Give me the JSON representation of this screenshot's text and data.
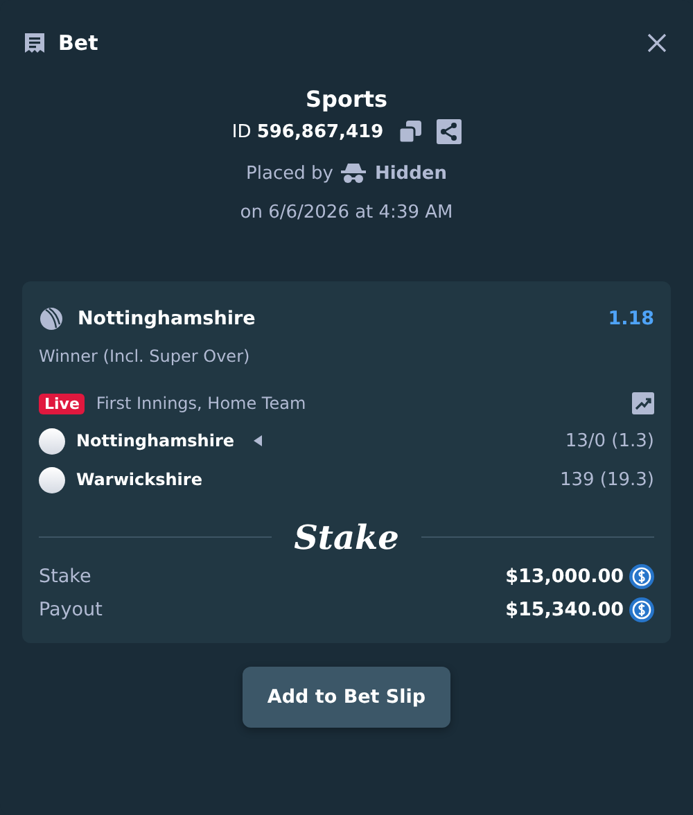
{
  "dialog": {
    "title": "Bet"
  },
  "header": {
    "category": "Sports",
    "id_label": "ID",
    "id_value": "596,867,419",
    "placed_by_label": "Placed by",
    "placed_by_user": "Hidden",
    "placed_on": "on 6/6/2026 at 4:39 AM"
  },
  "selection": {
    "team": "Nottinghamshire",
    "odds": "1.18",
    "market": "Winner (Incl. Super Over)"
  },
  "event": {
    "live_badge": "Live",
    "status": "First Innings, Home Team",
    "teams": [
      {
        "name": "Nottinghamshire",
        "batting": true,
        "score": "13/0 (1.3)"
      },
      {
        "name": "Warwickshire",
        "batting": false,
        "score": "139 (19.3)"
      }
    ]
  },
  "brand": "Stake",
  "totals": [
    {
      "label": "Stake",
      "amount": "$13,000.00"
    },
    {
      "label": "Payout",
      "amount": "$15,340.00"
    }
  ],
  "action_button": "Add to Bet Slip"
}
